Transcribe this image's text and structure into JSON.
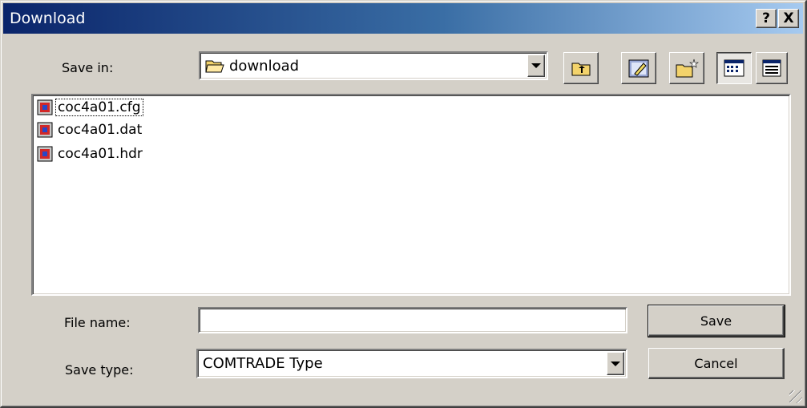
{
  "window": {
    "title": "Download"
  },
  "title_buttons": {
    "help": "?",
    "close": "X"
  },
  "save_in": {
    "label": "Save in:",
    "value": "download"
  },
  "toolbar": [
    {
      "name": "up-one-level-button",
      "icon": "folder-up-icon"
    },
    {
      "name": "desktop-button",
      "icon": "desktop-icon"
    },
    {
      "name": "new-folder-button",
      "icon": "new-folder-icon"
    },
    {
      "name": "list-view-button",
      "icon": "list-view-icon"
    },
    {
      "name": "details-view-button",
      "icon": "details-view-icon"
    }
  ],
  "files": [
    {
      "name": "coc4a01.cfg",
      "icon": "file-icon"
    },
    {
      "name": "coc4a01.dat",
      "icon": "file-icon"
    },
    {
      "name": "coc4a01.hdr",
      "icon": "file-icon"
    }
  ],
  "file_name": {
    "label": "File name:",
    "value": ""
  },
  "save_type": {
    "label": "Save type:",
    "value": "COMTRADE Type"
  },
  "buttons": {
    "save": "Save",
    "cancel": "Cancel"
  }
}
